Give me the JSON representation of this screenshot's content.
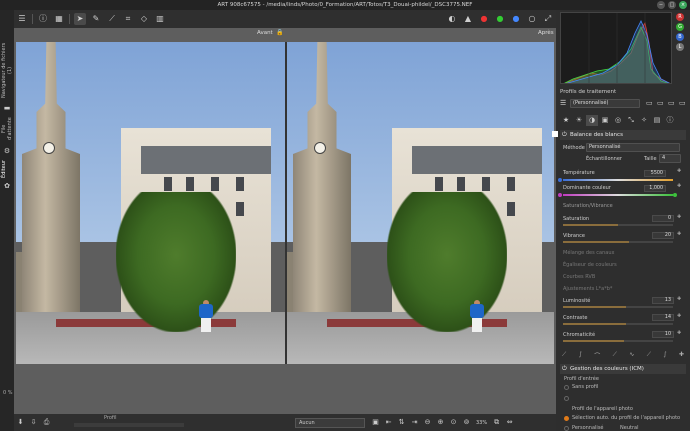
{
  "window": {
    "title": "ART 908c67575 - /media/linds/Photo/0_Formation/ART/Totos/T3_Douai-phildel/_DSC3775.NEF",
    "controls": {
      "minimize": "−",
      "maximize": "□",
      "close": "×"
    }
  },
  "toolbar": {
    "icons": [
      "history-icon",
      "info-icon",
      "panels-icon",
      "cursor-icon",
      "eyedropper-icon",
      "straighten-icon",
      "crop-icon",
      "perspective-icon",
      "grid-icon"
    ]
  },
  "left_tabs": {
    "file_browser": "Navigateur de fichiers (1)",
    "queue": "File d'attente",
    "editor": "Éditeur",
    "progress_pct": "0 %"
  },
  "viewer": {
    "before_label": "Avant",
    "after_label": "Après"
  },
  "bottom": {
    "profile_label": "Profil",
    "zoom_select": "Aucun",
    "zoom_value": "33%"
  },
  "right": {
    "processing_profile_label": "Profils de traitement",
    "processing_profile_value": "(Personnalisé)",
    "white_balance": {
      "title": "Balance des blancs",
      "method_label": "Méthode",
      "method_value": "Personnalisé",
      "sample_label": "Échantillonner",
      "size_label": "Taille",
      "size_value": "4",
      "temperature_label": "Température",
      "temperature_value": "5500",
      "temperature_frac": 0.5,
      "tint_label": "Dominante couleur",
      "tint_value": "1,000",
      "tint_frac": 0.5
    },
    "sat_vib_header": "Saturation/Vibrance",
    "saturation_label": "Saturation",
    "saturation_value": "0",
    "saturation_frac": 0.5,
    "vibrance_label": "Vibrance",
    "vibrance_value": "20",
    "vibrance_frac": 0.6,
    "disabled_sections": [
      "Mélange des canaux",
      "Égaliseur de couleurs",
      "Courbes RVB",
      "Ajustements L*a*b*"
    ],
    "luminosity_label": "Luminosité",
    "luminosity_value": "13",
    "luminosity_frac": 0.57,
    "contrast_label": "Contraste",
    "contrast_value": "14",
    "contrast_frac": 0.57,
    "chroma_label": "Chromaticité",
    "chroma_value": "10",
    "chroma_frac": 0.55,
    "icm": {
      "title": "Gestion des couleurs (ICM)",
      "input_profile_label": "Profil d'entrée",
      "no_profile": "Sans profil",
      "camera_profile": "Profil de l'appareil photo",
      "auto_camera": "Sélection auto. du profil de l'appareil photo",
      "custom": "Personnalisé",
      "custom_value": "Neutral"
    }
  },
  "colors": {
    "accent": "#e07b1a",
    "panel_bg": "#2e2e2e",
    "viewer_bg": "#5e5e5e"
  }
}
